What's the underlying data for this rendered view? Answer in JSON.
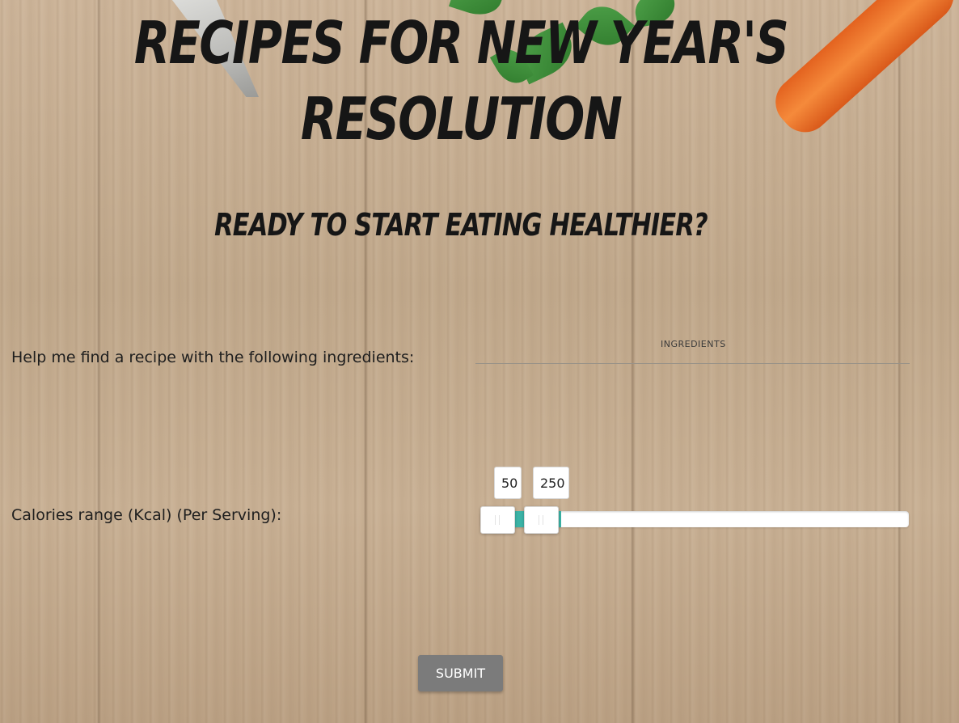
{
  "header": {
    "title": "Recipes for New Year's Resolution",
    "subtitle": "Ready to start eating healthier?"
  },
  "form": {
    "ingredients": {
      "label": "Help me find a recipe with the following ingredients:",
      "caption": "INGREDIENTS",
      "value": ""
    },
    "calories": {
      "label": "Calories range (Kcal) (Per Serving):",
      "min_value": "50",
      "max_value": "250"
    },
    "submit_label": "SUBMIT"
  },
  "colors": {
    "slider_accent": "#3bb3a6",
    "submit_bg": "#7b7b7b"
  },
  "icons": {
    "knife": "knife-decoration",
    "herbs": "parsley-leaves-decoration",
    "carrot": "carrot-decoration"
  }
}
